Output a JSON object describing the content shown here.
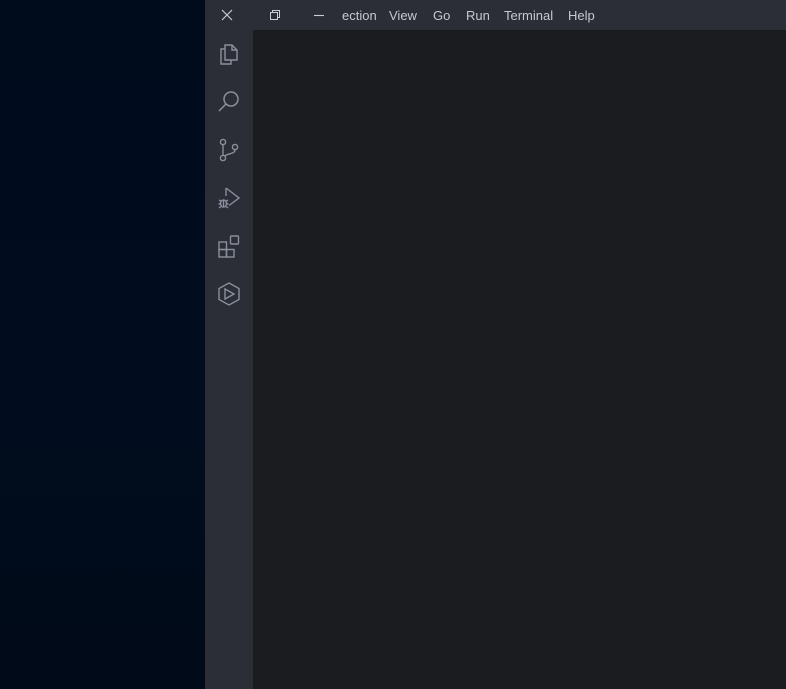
{
  "window": {
    "controls": {
      "close_icon": "close-icon",
      "restore_icon": "restore-icon",
      "minimize_icon": "minimize-icon"
    },
    "menu": {
      "items": [
        {
          "label": "ection"
        },
        {
          "label": "View"
        },
        {
          "label": "Go"
        },
        {
          "label": "Run"
        },
        {
          "label": "Terminal"
        },
        {
          "label": "Help"
        }
      ]
    },
    "activity_bar": {
      "icons": [
        "explorer-icon",
        "search-icon",
        "source-control-icon",
        "run-debug-icon",
        "extensions-icon",
        "remote-explorer-icon"
      ]
    }
  },
  "colors": {
    "desktop_bg": "#000b1c",
    "titlebar_bg": "#2b2e37",
    "activitybar_bg": "#2b2e37",
    "editor_bg": "#1b1c20",
    "icon_color": "#8a8f9c",
    "menu_text": "#c6c9d0"
  }
}
